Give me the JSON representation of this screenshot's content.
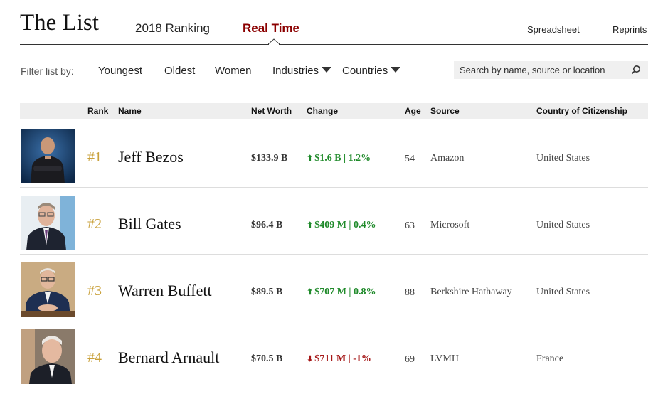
{
  "header": {
    "title": "The List",
    "tabs": [
      {
        "label": "2018 Ranking",
        "active": false
      },
      {
        "label": "Real Time",
        "active": true
      }
    ],
    "links": {
      "spreadsheet": "Spreadsheet",
      "reprints": "Reprints"
    }
  },
  "filters": {
    "label": "Filter list by:",
    "items": [
      "Youngest",
      "Oldest",
      "Women",
      "Industries",
      "Countries"
    ],
    "search_placeholder": "Search by name, source or location"
  },
  "columns": {
    "rank": "Rank",
    "name": "Name",
    "net_worth": "Net Worth",
    "change": "Change",
    "age": "Age",
    "source": "Source",
    "country": "Country of Citizenship"
  },
  "rows": [
    {
      "rank": "#1",
      "name": "Jeff Bezos",
      "net_worth": "$133.9 B",
      "change": "$1.6 B | 1.2%",
      "direction": "up",
      "age": "54",
      "source": "Amazon",
      "country": "United States"
    },
    {
      "rank": "#2",
      "name": "Bill Gates",
      "net_worth": "$96.4 B",
      "change": "$409 M | 0.4%",
      "direction": "up",
      "age": "63",
      "source": "Microsoft",
      "country": "United States"
    },
    {
      "rank": "#3",
      "name": "Warren Buffett",
      "net_worth": "$89.5 B",
      "change": "$707 M | 0.8%",
      "direction": "up",
      "age": "88",
      "source": "Berkshire Hathaway",
      "country": "United States"
    },
    {
      "rank": "#4",
      "name": "Bernard Arnault",
      "net_worth": "$70.5 B",
      "change": "$711 M | -1%",
      "direction": "down",
      "age": "69",
      "source": "LVMH",
      "country": "France"
    }
  ],
  "colors": {
    "active_tab": "#8b0000",
    "rank_gold": "#c9a13b",
    "change_up": "#1f8a2a",
    "change_down": "#a51717"
  }
}
